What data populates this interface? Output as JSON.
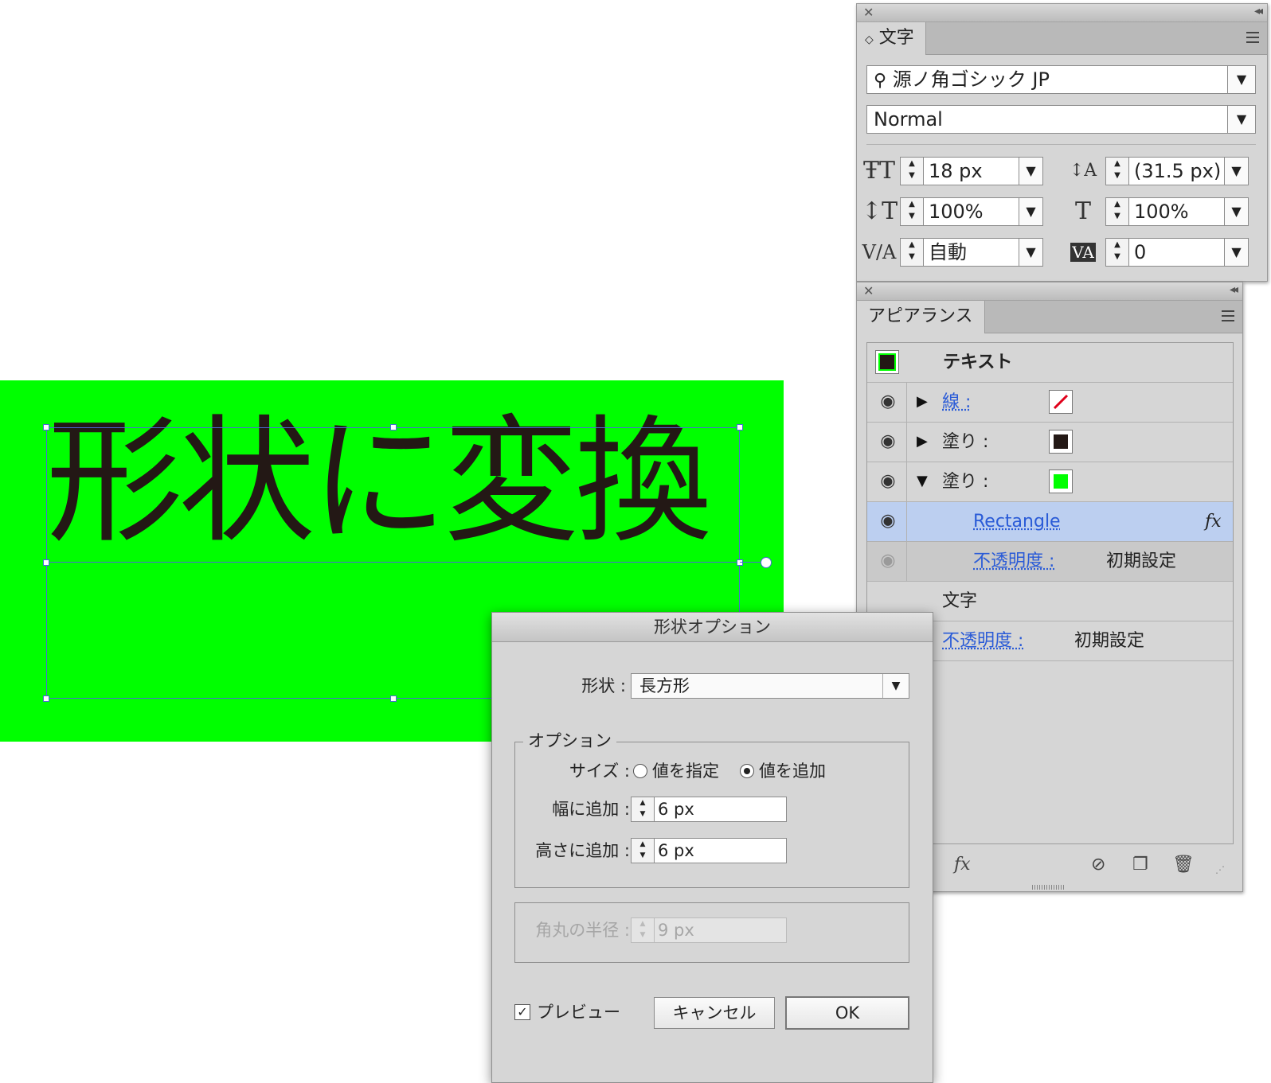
{
  "canvas": {
    "art_text": "形状に変換",
    "art_color": "#231815",
    "bg_color": "#00ff00"
  },
  "character_panel": {
    "tab": "文字",
    "font_family": "源ノ角ゴシック JP",
    "font_style": "Normal",
    "font_size": "18 px",
    "leading": "(31.5 px)",
    "vertical_scale": "100%",
    "horizontal_scale": "100%",
    "kerning": "自動",
    "tracking": "0"
  },
  "appearance_panel": {
    "tab": "アピアランス",
    "object": "テキスト",
    "rows": [
      {
        "label": "線 :"
      },
      {
        "label": "塗り :"
      },
      {
        "label": "塗り :"
      },
      {
        "label": "Rectangle",
        "fx": "fx"
      },
      {
        "label": "不透明度 :",
        "value": "初期設定"
      },
      {
        "label": "文字"
      },
      {
        "label": "不透明度 :",
        "value": "初期設定"
      }
    ],
    "footer_fx": "fx"
  },
  "dialog": {
    "title": "形状オプション",
    "shape_label": "形状 :",
    "shape_value": "長方形",
    "options_legend": "オプション",
    "size_label": "サイズ :",
    "radio_fixed": "値を指定",
    "radio_add": "値を追加",
    "width_label": "幅に追加 :",
    "width_value": "6 px",
    "height_label": "高さに追加 :",
    "height_value": "6 px",
    "radius_label": "角丸の半径 :",
    "radius_value": "9 px",
    "preview_label": "プレビュー",
    "cancel_label": "キャンセル",
    "ok_label": "OK"
  }
}
